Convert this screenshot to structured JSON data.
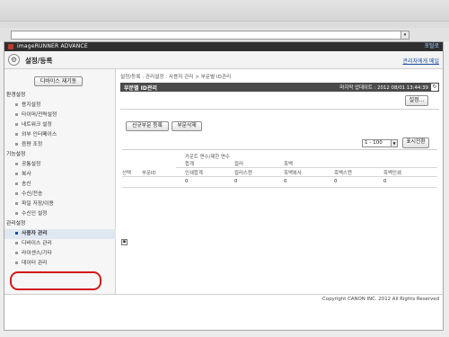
{
  "browser": {
    "address_value": "",
    "dropdown_glyph": "▾"
  },
  "brand": {
    "product": "imageRUNNER ADVANCE",
    "link": "포털로"
  },
  "header": {
    "title": "설정/등록",
    "right_link": "관리자에게 메일"
  },
  "sidebar": {
    "restart_label": "디바이스 재기동",
    "items": [
      {
        "kind": "head",
        "label": "환경설정"
      },
      {
        "kind": "item",
        "label": "용지설정"
      },
      {
        "kind": "item",
        "label": "타이머/전력설정"
      },
      {
        "kind": "item",
        "label": "네트워크 설정"
      },
      {
        "kind": "item",
        "label": "외부 인터페이스"
      },
      {
        "kind": "item",
        "label": "음량 조정"
      },
      {
        "kind": "head",
        "label": "기능설정"
      },
      {
        "kind": "item",
        "label": "공통설정"
      },
      {
        "kind": "item",
        "label": "복사"
      },
      {
        "kind": "item",
        "label": "송신"
      },
      {
        "kind": "item",
        "label": "수신/전송"
      },
      {
        "kind": "item",
        "label": "파일 저장/이용"
      },
      {
        "kind": "item",
        "label": "수신인 설정"
      },
      {
        "kind": "head",
        "label": "관리설정"
      },
      {
        "kind": "item",
        "label": "사용자 관리",
        "active": true
      },
      {
        "kind": "item",
        "label": "디바이스 관리"
      },
      {
        "kind": "item",
        "label": "라이센스/기타"
      },
      {
        "kind": "item",
        "label": "데이터 관리"
      }
    ]
  },
  "main": {
    "breadcrumb": "설정/등록 : 관리설정 : 사용자 관리 > 부문별 ID관리",
    "panel_title": "부문별 ID관리",
    "last_updated": "마지막 업데이트 : 2012 08/01 13:44:39",
    "refresh_glyph": "↻",
    "settings_label": "설정...",
    "new_label": "신규부문 등록",
    "delete_label": "부문삭제",
    "range_value": "1 - 100",
    "show_label": "표시전환",
    "table": {
      "group_header": "카운트 면수/제한 면수",
      "sub_total": "합계",
      "sub_color": "컬러",
      "sub_bw": "흑백",
      "columns": [
        "선택",
        "부문ID",
        "인쇄합계",
        "컬러스캔",
        "흑백복사",
        "흑백스캔",
        "흑백인쇄"
      ],
      "values": [
        "0",
        "0",
        "0",
        "0",
        "0"
      ]
    },
    "section_toggle": "▪"
  },
  "footer": {
    "copyright": "Copyright CANON INC. 2012 All Rights Reserved"
  },
  "colors": {
    "highlight": "#d11a1a",
    "link": "#1a4fa0",
    "bar": "#4a4a4a"
  }
}
